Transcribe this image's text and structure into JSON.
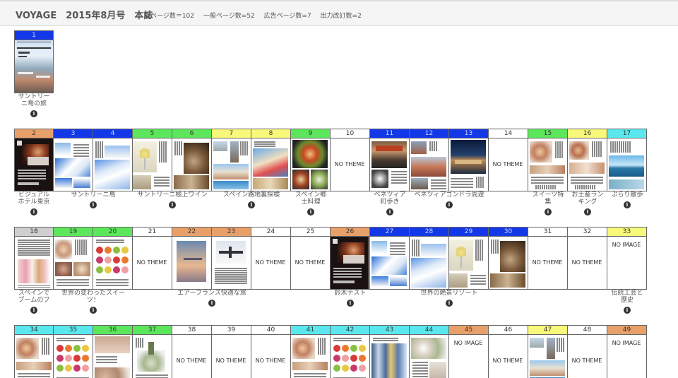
{
  "header": {
    "title": "VOYAGE　2015年8月号　本誌",
    "stats": [
      "総ページ数＝102",
      "一般ページ数=52",
      "広告ページ数=7",
      "出力改訂数=2"
    ]
  },
  "colors": {
    "blue": "#1338e8",
    "green": "#5ce65c",
    "orange": "#e8a06a",
    "yellow": "#f8f87a",
    "cyan": "#5ae8ee",
    "gray": "#cfcfcf",
    "white": "#ffffff"
  },
  "texts": {
    "no_theme": "NO THEME",
    "no_image": "NO IMAGE",
    "info": "i"
  },
  "rows": [
    {
      "pages": [
        {
          "num": "1",
          "color": "blue",
          "thumb": "cover"
        }
      ],
      "labels": [
        {
          "start": 0,
          "span": 1,
          "lines": [
            "サントリー",
            "ニ島の旅"
          ]
        }
      ]
    },
    {
      "pages": [
        {
          "num": "2",
          "color": "orange",
          "thumb": "hotel"
        },
        {
          "num": "3",
          "color": "blue",
          "thumb": "santorini"
        },
        {
          "num": "4",
          "color": "blue",
          "thumb": "whitetown"
        },
        {
          "num": "5",
          "color": "green",
          "thumb": "wine"
        },
        {
          "num": "6",
          "color": "green",
          "thumb": "barrels"
        },
        {
          "num": "7",
          "color": "yellow",
          "thumb": "city"
        },
        {
          "num": "8",
          "color": "yellow",
          "thumb": "street"
        },
        {
          "num": "9",
          "color": "green",
          "thumb": "food"
        },
        {
          "num": "10",
          "color": "white",
          "thumb": "none"
        },
        {
          "num": "11",
          "color": "blue",
          "thumb": "shop"
        },
        {
          "num": "12",
          "color": "blue",
          "thumb": "venice"
        },
        {
          "num": "13",
          "color": "blue",
          "thumb": "bridge"
        },
        {
          "num": "14",
          "color": "white",
          "thumb": "none"
        },
        {
          "num": "15",
          "color": "green",
          "thumb": "sweets"
        },
        {
          "num": "16",
          "color": "yellow",
          "thumb": "sweets2"
        },
        {
          "num": "17",
          "color": "cyan",
          "thumb": "sea"
        }
      ],
      "labels": [
        {
          "start": 0,
          "span": 1,
          "lines": [
            "ビジュアル",
            "ホテル東京"
          ]
        },
        {
          "start": 1,
          "span": 2,
          "lines": [
            "サントリーニ島"
          ]
        },
        {
          "start": 3,
          "span": 2,
          "lines": [
            "サントリーニ極上ワイン"
          ]
        },
        {
          "start": 5,
          "span": 2,
          "lines": [
            "スペイン路地裏探検"
          ]
        },
        {
          "start": 7,
          "span": 1,
          "lines": [
            "スペイン郷",
            "土料理"
          ]
        },
        {
          "start": 9,
          "span": 1,
          "lines": [
            "ベネツィア",
            "町歩き"
          ]
        },
        {
          "start": 10,
          "span": 2,
          "lines": [
            "ベネツィアゴンドラ周遊"
          ]
        },
        {
          "start": 13,
          "span": 1,
          "lines": [
            "スイーツ特",
            "集"
          ]
        },
        {
          "start": 14,
          "span": 1,
          "lines": [
            "お土産ラン",
            "キング"
          ]
        },
        {
          "start": 15,
          "span": 1,
          "lines": [
            "ぶらり散歩"
          ]
        }
      ]
    },
    {
      "pages": [
        {
          "num": "18",
          "color": "gray",
          "thumb": "cosme"
        },
        {
          "num": "19",
          "color": "green",
          "thumb": "sweets3"
        },
        {
          "num": "20",
          "color": "green",
          "thumb": "fruits"
        },
        {
          "num": "21",
          "color": "white",
          "thumb": "none"
        },
        {
          "num": "22",
          "color": "orange",
          "thumb": "sky"
        },
        {
          "num": "23",
          "color": "orange",
          "thumb": "plane"
        },
        {
          "num": "24",
          "color": "white",
          "thumb": "none"
        },
        {
          "num": "25",
          "color": "white",
          "thumb": "none"
        },
        {
          "num": "26",
          "color": "orange",
          "thumb": "hotel"
        },
        {
          "num": "27",
          "color": "blue",
          "thumb": "santorini"
        },
        {
          "num": "28",
          "color": "blue",
          "thumb": "whitetown"
        },
        {
          "num": "29",
          "color": "blue",
          "thumb": "wine"
        },
        {
          "num": "30",
          "color": "blue",
          "thumb": "barrels"
        },
        {
          "num": "31",
          "color": "white",
          "thumb": "none"
        },
        {
          "num": "32",
          "color": "white",
          "thumb": "none"
        },
        {
          "num": "33",
          "color": "yellow",
          "thumb": "noimage"
        }
      ],
      "labels": [
        {
          "start": 0,
          "span": 1,
          "lines": [
            "スペインで",
            "ブームのフ"
          ]
        },
        {
          "start": 1,
          "span": 2,
          "lines": [
            "世界の変わったスイー",
            "ツ！"
          ]
        },
        {
          "start": 4,
          "span": 2,
          "lines": [
            "エアーフランス快適な旅"
          ]
        },
        {
          "start": 8,
          "span": 1,
          "lines": [
            "鈴木テスト"
          ]
        },
        {
          "start": 9,
          "span": 4,
          "lines": [
            "世界の絶景リゾート"
          ]
        },
        {
          "start": 15,
          "span": 1,
          "lines": [
            "伝統工芸と",
            "歴史"
          ]
        }
      ]
    },
    {
      "pages": [
        {
          "num": "34",
          "color": "cyan",
          "thumb": "sweets"
        },
        {
          "num": "35",
          "color": "cyan",
          "thumb": "fruits"
        },
        {
          "num": "36",
          "color": "green",
          "thumb": "face"
        },
        {
          "num": "37",
          "color": "green",
          "thumb": "bottle"
        },
        {
          "num": "38",
          "color": "white",
          "thumb": "none"
        },
        {
          "num": "39",
          "color": "white",
          "thumb": "none"
        },
        {
          "num": "40",
          "color": "white",
          "thumb": "none"
        },
        {
          "num": "41",
          "color": "cyan",
          "thumb": "sweets"
        },
        {
          "num": "42",
          "color": "cyan",
          "thumb": "fruits"
        },
        {
          "num": "43",
          "color": "cyan",
          "thumb": "nyc"
        },
        {
          "num": "44",
          "color": "cyan",
          "thumb": "flowers"
        },
        {
          "num": "45",
          "color": "orange",
          "thumb": "noimage"
        },
        {
          "num": "46",
          "color": "white",
          "thumb": "none"
        },
        {
          "num": "47",
          "color": "yellow",
          "thumb": "city"
        },
        {
          "num": "48",
          "color": "white",
          "thumb": "none"
        },
        {
          "num": "49",
          "color": "orange",
          "thumb": "noimage"
        }
      ],
      "labels": []
    }
  ]
}
